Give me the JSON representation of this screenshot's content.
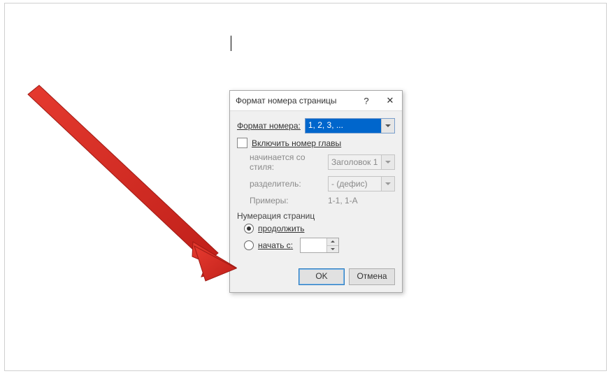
{
  "dialog": {
    "title": "Формат номера страницы",
    "format_label": "Формат номера:",
    "format_value": "1, 2, 3, ...",
    "include_chapter_label": "Включить номер главы",
    "chapter": {
      "starts_label": "начинается со стиля:",
      "starts_value": "Заголовок 1",
      "separator_label": "разделитель:",
      "separator_value": "-   (дефис)",
      "examples_label": "Примеры:",
      "examples_value": "1-1, 1-A"
    },
    "numbering_label": "Нумерация страниц",
    "continue_label": "продолжить",
    "start_at_label": "начать с:",
    "start_at_value": "",
    "ok_label": "OK",
    "cancel_label": "Отмена"
  }
}
